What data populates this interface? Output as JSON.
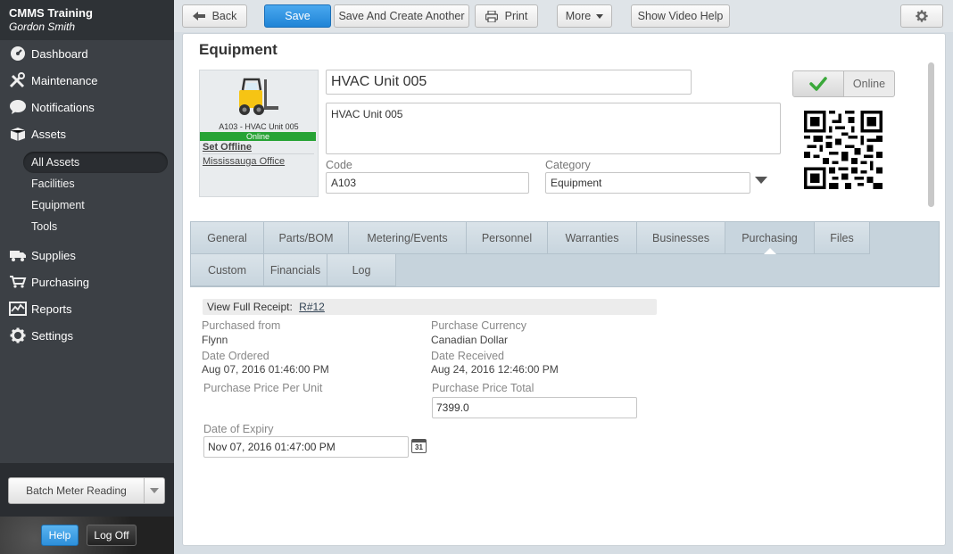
{
  "sidebar": {
    "org": "CMMS Training",
    "user": "Gordon Smith",
    "nav": [
      {
        "label": "Dashboard",
        "icon": "dashboard-icon"
      },
      {
        "label": "Maintenance",
        "icon": "tools-icon"
      },
      {
        "label": "Notifications",
        "icon": "chat-bubble-icon"
      },
      {
        "label": "Assets",
        "icon": "box-icon"
      }
    ],
    "assets_sub": [
      "All Assets",
      "Facilities",
      "Equipment",
      "Tools"
    ],
    "nav2": [
      {
        "label": "Supplies",
        "icon": "truck-icon"
      },
      {
        "label": "Purchasing",
        "icon": "cart-icon"
      },
      {
        "label": "Reports",
        "icon": "chart-icon"
      },
      {
        "label": "Settings",
        "icon": "gear-icon"
      }
    ],
    "batch_label": "Batch Meter Reading",
    "help_label": "Help",
    "logoff_label": "Log Off"
  },
  "toolbar": {
    "back": "Back",
    "save": "Save",
    "save_create": "Save And Create Another",
    "print": "Print",
    "more": "More",
    "video_help": "Show Video Help"
  },
  "equipment": {
    "section_title": "Equipment",
    "caption": "A103 - HVAC Unit 005",
    "status_badge": "Online",
    "set_offline": "Set Offline",
    "location": "Mississauga Office",
    "name": "HVAC Unit 005",
    "description": "HVAC Unit 005",
    "code_label": "Code",
    "code": "A103",
    "category_label": "Category",
    "category": "Equipment",
    "status_label": "Online"
  },
  "tabs": {
    "row1": [
      "General",
      "Parts/BOM",
      "Metering/Events",
      "Personnel",
      "Warranties",
      "Businesses",
      "Purchasing",
      "Files"
    ],
    "row2": [
      "Custom",
      "Financials",
      "Log"
    ],
    "active": "Purchasing"
  },
  "purchasing": {
    "receipt_label": "View Full Receipt:",
    "receipt_link": "R#12",
    "purchased_from_label": "Purchased from",
    "purchased_from": "Flynn",
    "currency_label": "Purchase Currency",
    "currency": "Canadian Dollar",
    "date_ordered_label": "Date Ordered",
    "date_ordered": "Aug 07, 2016 01:46:00 PM",
    "date_received_label": "Date Received",
    "date_received": "Aug 24, 2016 12:46:00 PM",
    "price_per_unit_label": "Purchase Price Per Unit",
    "price_total_label": "Purchase Price Total",
    "price_total": "7399.0",
    "expiry_label": "Date of Expiry",
    "expiry": "Nov 07, 2016 01:47:00 PM",
    "calendar_text": "31"
  },
  "colors": {
    "accent": "#2d8fdb",
    "online_green": "#27a335",
    "sidebar_bg": "#3c4045"
  }
}
